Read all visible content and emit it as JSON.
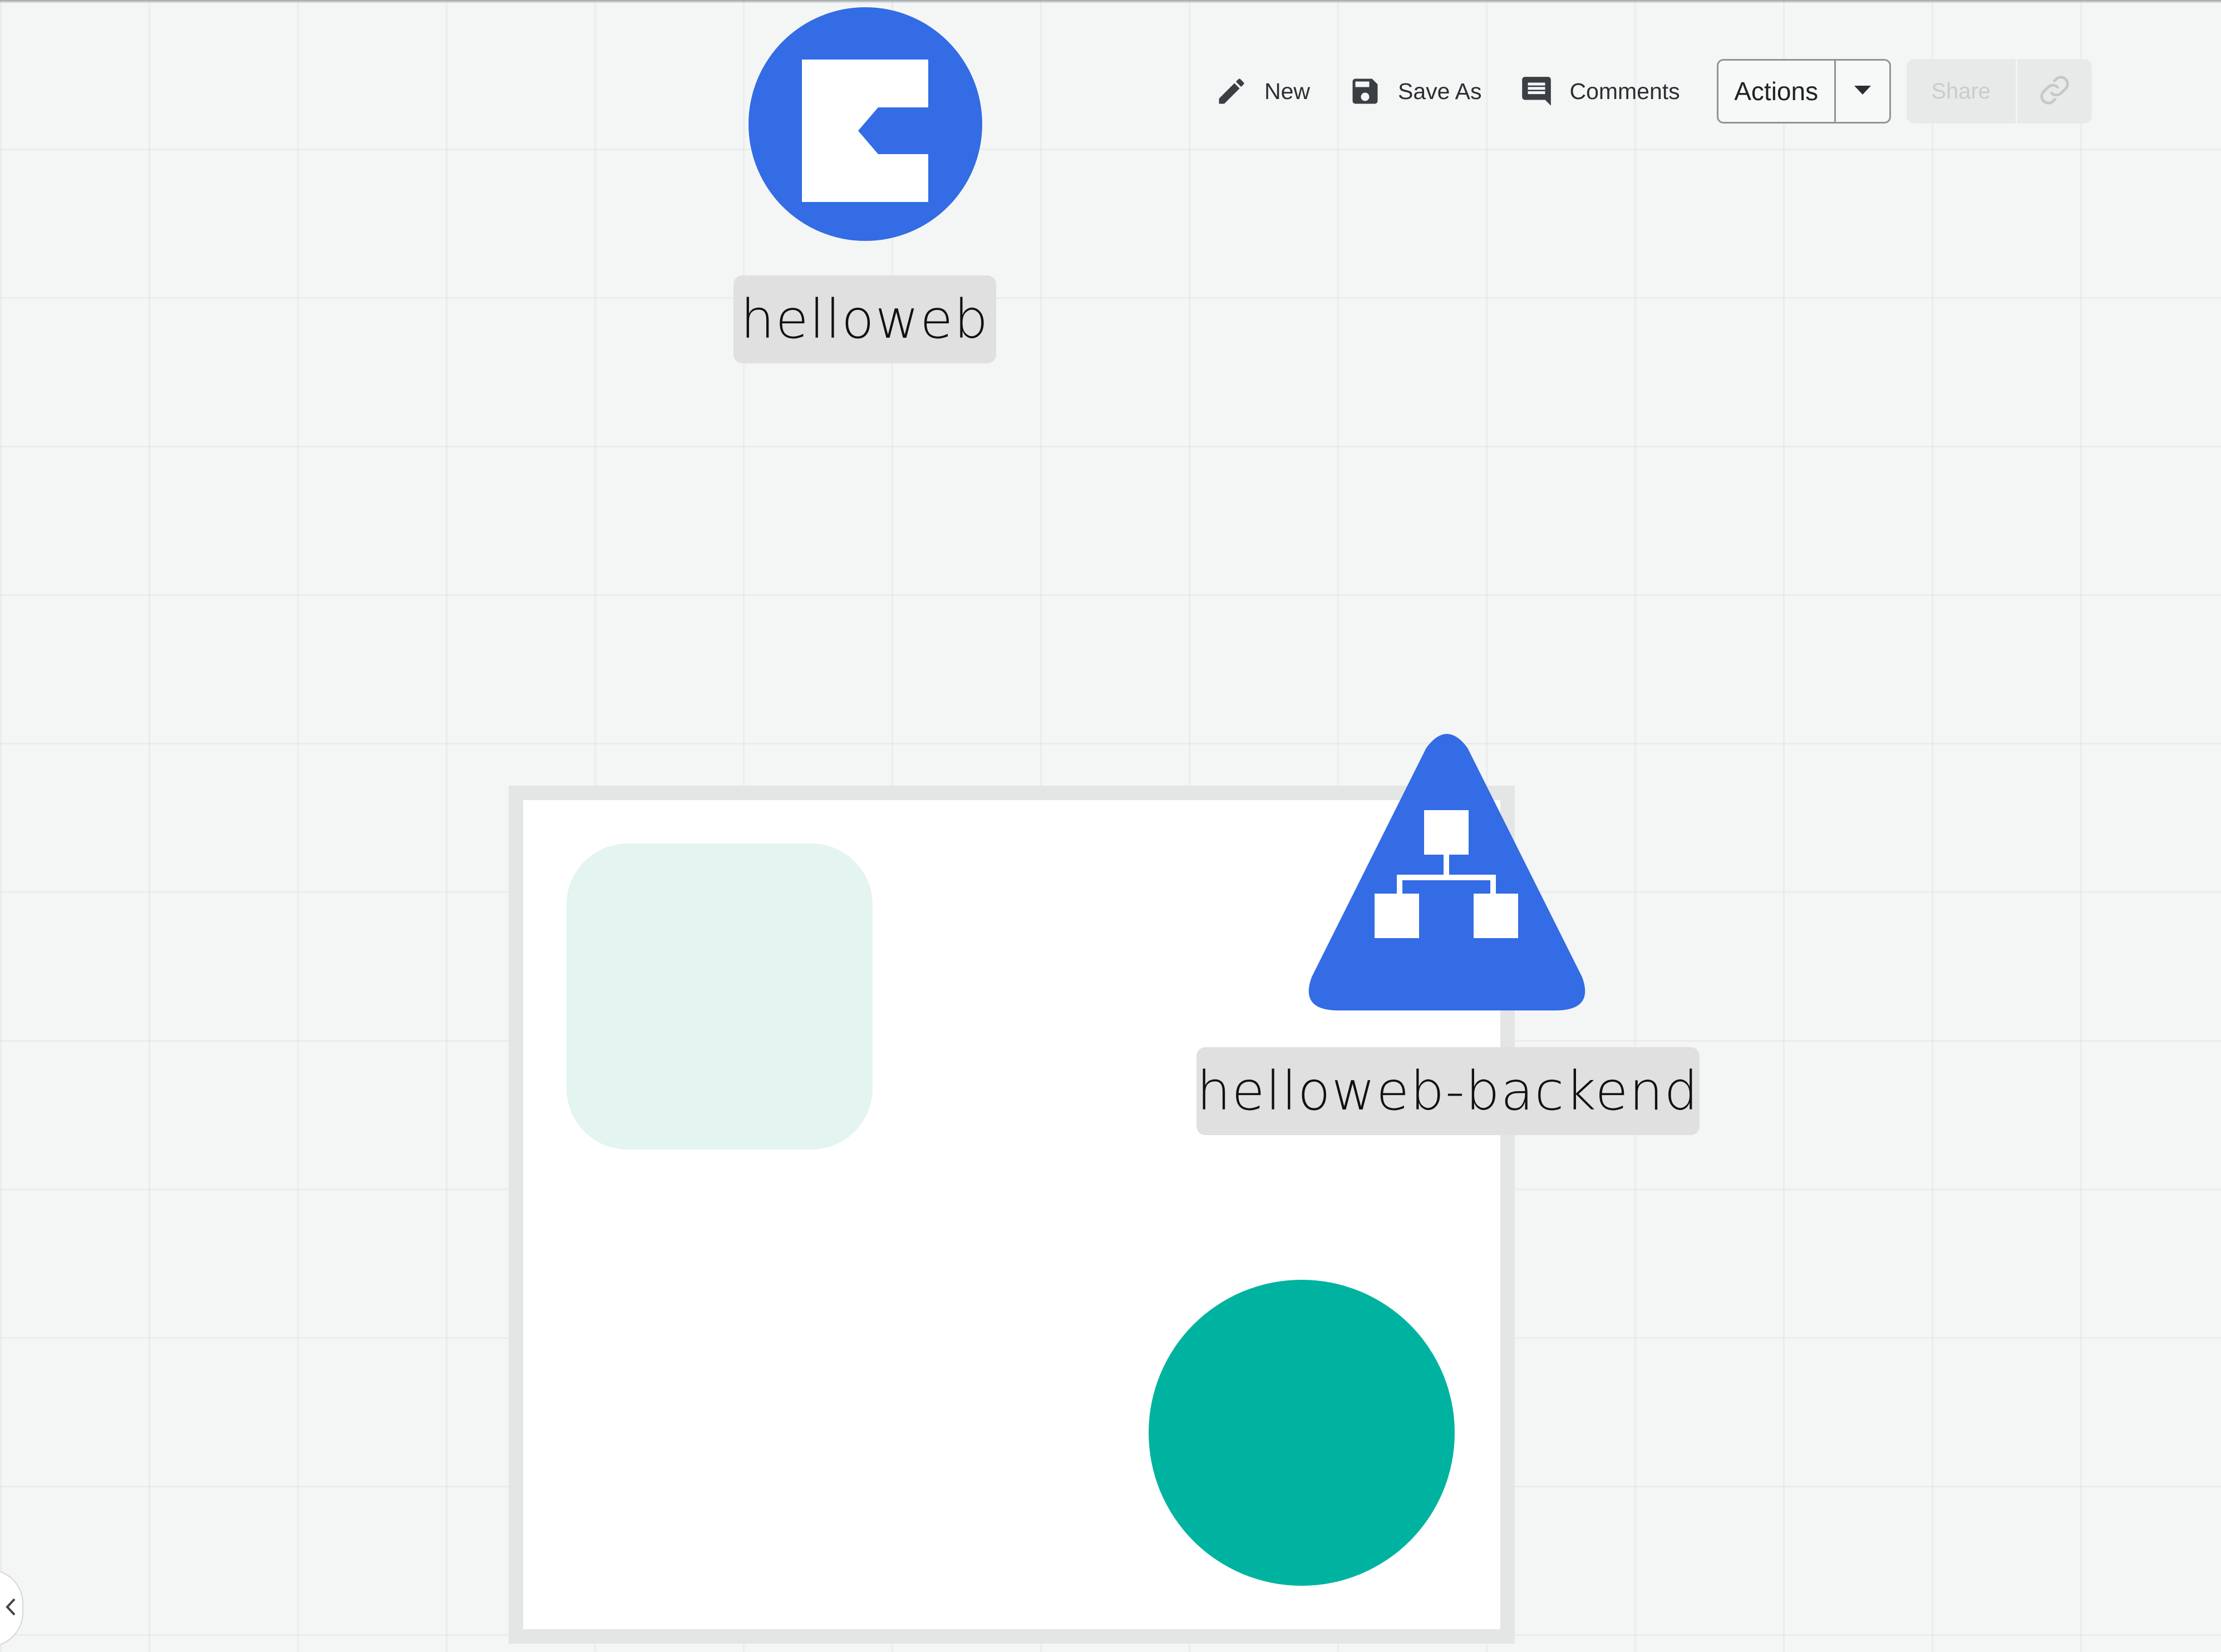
{
  "toolbar": {
    "new_label": "New",
    "save_as_label": "Save As",
    "comments_label": "Comments",
    "actions_label": "Actions",
    "share_label": "Share",
    "icons": {
      "new": "pencil-icon",
      "save_as": "floppy-disk-icon",
      "comments": "comment-icon",
      "actions_menu": "caret-down-icon",
      "share_link": "link-icon"
    }
  },
  "canvas": {
    "nodes": [
      {
        "label": "helloweb",
        "icon": "ingress-icon",
        "color": "#336ce4"
      },
      {
        "label": "helloweb-backend",
        "icon": "network-hierarchy-icon",
        "color": "#336ce4"
      }
    ],
    "group_color": "#ffffff",
    "shapes": {
      "rounded_square_color": "#e3f4f1",
      "circle_color": "#00b3a0"
    }
  },
  "sidebar": {
    "toggle_icon": "chevron-left-icon"
  }
}
